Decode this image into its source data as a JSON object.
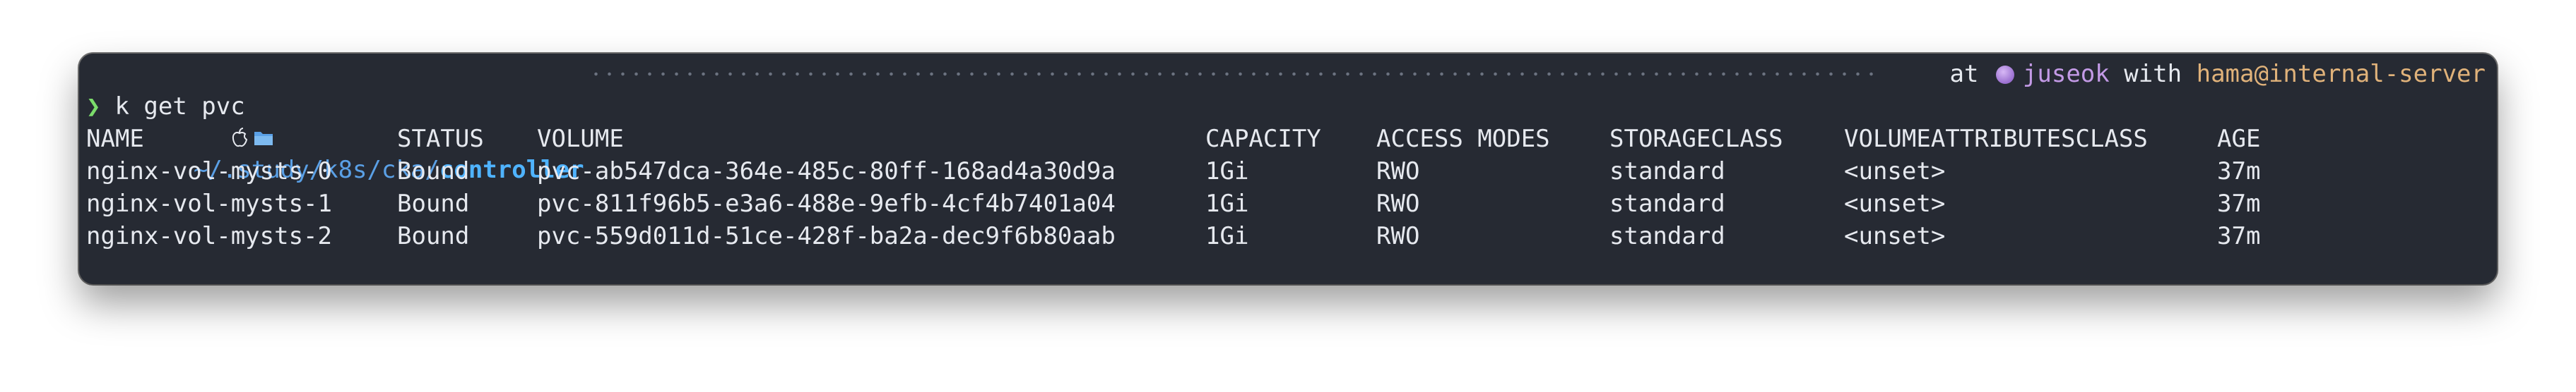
{
  "window": {
    "type": "terminal",
    "background_color": "#262a33"
  },
  "prompt": {
    "os_icon": "apple-icon",
    "folder_icon": "folder-icon",
    "path_prefix": "~/.study/k8s/cka/",
    "path_current": "controller",
    "at_word": "at",
    "user_icon": "purple-orb-icon",
    "user": "juseok",
    "with_word": "with",
    "host": "hama@internal-server",
    "colors": {
      "path": "#5aa0e6",
      "user": "#c39ae6",
      "host": "#e0b27a",
      "chevron": "#7bdc6b"
    }
  },
  "command": {
    "symbol": "❯",
    "text": "k get pvc"
  },
  "table": {
    "headers": [
      "NAME",
      "STATUS",
      "VOLUME",
      "CAPACITY",
      "ACCESS MODES",
      "STORAGECLASS",
      "VOLUMEATTRIBUTESCLASS",
      "AGE"
    ],
    "rows": [
      [
        "nginx-vol-mysts-0",
        "Bound",
        "pvc-ab547dca-364e-485c-80ff-168ad4a30d9a",
        "1Gi",
        "RWO",
        "standard",
        "<unset>",
        "37m"
      ],
      [
        "nginx-vol-mysts-1",
        "Bound",
        "pvc-811f96b5-e3a6-488e-9efb-4cf4b7401a04",
        "1Gi",
        "RWO",
        "standard",
        "<unset>",
        "37m"
      ],
      [
        "nginx-vol-mysts-2",
        "Bound",
        "pvc-559d011d-51ce-428f-ba2a-dec9f6b80aab",
        "1Gi",
        "RWO",
        "standard",
        "<unset>",
        "37m"
      ]
    ]
  }
}
